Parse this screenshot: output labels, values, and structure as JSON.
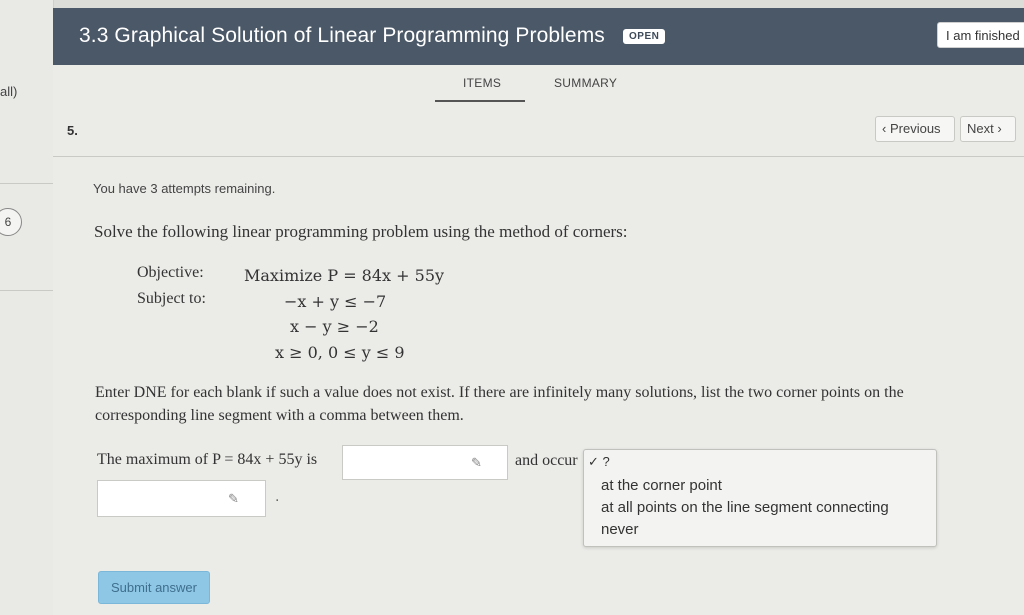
{
  "sidebar": {
    "fragment": "all)",
    "item_number": "6"
  },
  "header": {
    "title": "3.3 Graphical Solution of Linear Programming Problems",
    "badge": "OPEN",
    "finished_label": "I am finished"
  },
  "tabs": {
    "items": "ITEMS",
    "summary": "SUMMARY"
  },
  "question": {
    "number": "5.",
    "previous_label": "Previous",
    "next_label": "Next",
    "attempts": "You have 3 attempts remaining.",
    "prompt": "Solve the following linear programming problem using the method of corners:",
    "objective_label": "Objective:",
    "objective": "Maximize P = 84x + 55y",
    "subject_label": "Subject to:",
    "constraints": [
      "−x + y ≤ −7",
      "x − y ≥ −2",
      "x ≥ 0, 0 ≤ y ≤ 9"
    ],
    "instructions": "Enter DNE for each blank if such a value does not exist. If there are infinitely many solutions, list the two corner points on the corresponding line segment with a comma between them.",
    "answer_lead": "The maximum of P = 84x + 55y is",
    "and_occurs": "and occur",
    "dropdown_selected": "?",
    "dropdown_options": [
      "at the corner point",
      "at all points on the line segment connecting",
      "never"
    ],
    "period": ".",
    "submit_label": "Submit answer"
  },
  "icons": {
    "pencil": "pencil-icon",
    "prev": "chevron-left-icon",
    "next": "chevron-right-icon",
    "check": "check-icon"
  },
  "colors": {
    "header_bg": "#4b5868",
    "submit_bg": "#8ec7e6"
  }
}
